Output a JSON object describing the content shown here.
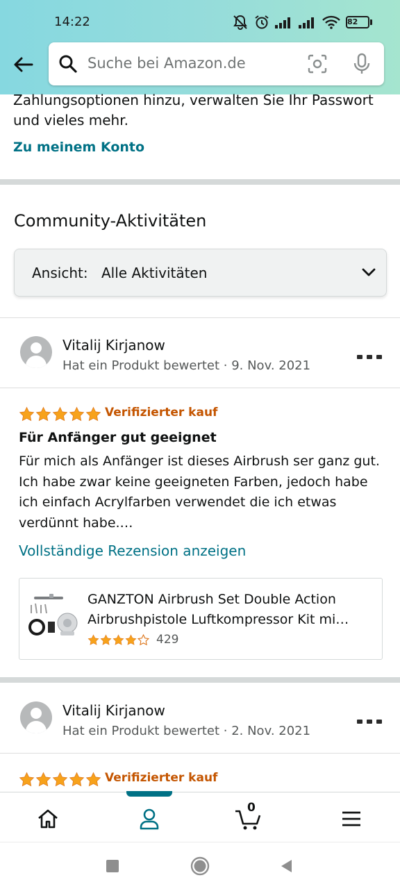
{
  "status_bar": {
    "time": "14:22",
    "battery": "82"
  },
  "search": {
    "placeholder": "Suche bei Amazon.de"
  },
  "account": {
    "text": "Zahlungsoptionen hinzu, verwalten Sie Ihr Passwort und vieles mehr.",
    "link": "Zu meinem Konto"
  },
  "community": {
    "title": "Community-Aktivitäten",
    "view_label": "Ansicht:",
    "view_value": "Alle Aktivitäten"
  },
  "activities": [
    {
      "user": "Vitalij Kirjanow",
      "meta": "Hat ein Produkt bewertet · 9. Nov. 2021",
      "rating": 5,
      "verified": "Verifizierter kauf",
      "title": "Für Anfänger gut geeignet",
      "body": "Für mich als Anfänger ist dieses Airbrush ser ganz gut. Ich habe zwar keine geeigneten Farben, jedoch habe ich einfach Acrylfarben verwendet die ich etwas verdünnt habe.…",
      "link": "Vollständige Rezension anzeigen",
      "product": {
        "title_line1": "GANZTON Airbrush Set Double Action",
        "title_line2": "Airbrushpistole Luftkompressor Kit mi…",
        "rating": 4.5,
        "count": "429"
      }
    },
    {
      "user": "Vitalij Kirjanow",
      "meta": "Hat ein Produkt bewertet · 2. Nov. 2021",
      "rating": 5,
      "verified": "Verifizierter kauf"
    }
  ],
  "bottom_nav": {
    "cart_count": "0",
    "items": [
      "home-icon",
      "account-icon",
      "cart-icon",
      "menu-icon"
    ],
    "active": "account-icon"
  },
  "colors": {
    "header_gradient_start": "#86d8e0",
    "header_gradient_end": "#a5e5cf",
    "link": "#007185",
    "verified": "#c45500",
    "star": "#f7a21b"
  }
}
